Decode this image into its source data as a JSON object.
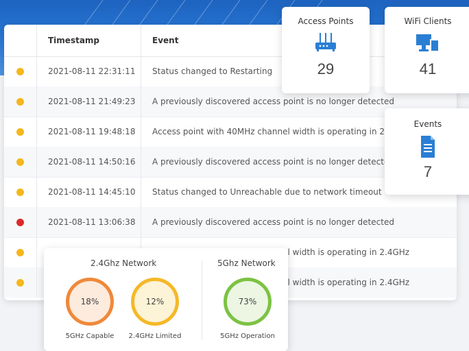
{
  "table": {
    "headers": {
      "timestamp": "Timestamp",
      "event": "Event"
    },
    "rows": [
      {
        "status": "warning",
        "timestamp": "2021-08-11 22:31:11",
        "event": "Status changed to Restarting"
      },
      {
        "status": "warning",
        "timestamp": "2021-08-11 21:49:23",
        "event": "A previously discovered access point is no longer detected"
      },
      {
        "status": "warning",
        "timestamp": "2021-08-11 19:48:18",
        "event": "Access point with 40MHz channel width is operating in 2.4GHz"
      },
      {
        "status": "warning",
        "timestamp": "2021-08-11 14:50:16",
        "event": "A previously discovered access point is no longer detected"
      },
      {
        "status": "warning",
        "timestamp": "2021-08-11 14:45:10",
        "event": "Status changed to Unreachable due to network timeout"
      },
      {
        "status": "error",
        "timestamp": "2021-08-11 13:06:38",
        "event": "A previously discovered access point is no longer detected"
      },
      {
        "status": "warning",
        "timestamp": "",
        "event": "Access point with 40MHz channel width is operating in 2.4GHz"
      },
      {
        "status": "warning",
        "timestamp": "",
        "event": "Access point with 40MHz channel width is operating in 2.4GHz"
      }
    ]
  },
  "stats": {
    "access_points": {
      "label": "Access Points",
      "value": "29",
      "icon": "router-icon"
    },
    "wifi_clients": {
      "label": "WiFi Clients",
      "value": "41",
      "icon": "devices-icon"
    },
    "events": {
      "label": "Events",
      "value": "7",
      "icon": "document-icon"
    }
  },
  "networks": {
    "ghz24": {
      "title": "2.4Ghz Network",
      "gauges": [
        {
          "value": "18%",
          "label": "5GHz Capable",
          "color": "#f0883a"
        },
        {
          "value": "12%",
          "label": "2.4GHz Limited",
          "color": "#f5b828"
        }
      ]
    },
    "ghz5": {
      "title": "5Ghz Network",
      "gauges": [
        {
          "value": "73%",
          "label": "5GHz Operation",
          "color": "#7cc243"
        }
      ]
    }
  },
  "colors": {
    "warning": "#f5b71c",
    "error": "#dc2a2a",
    "header_blue": "#2a78d6"
  }
}
